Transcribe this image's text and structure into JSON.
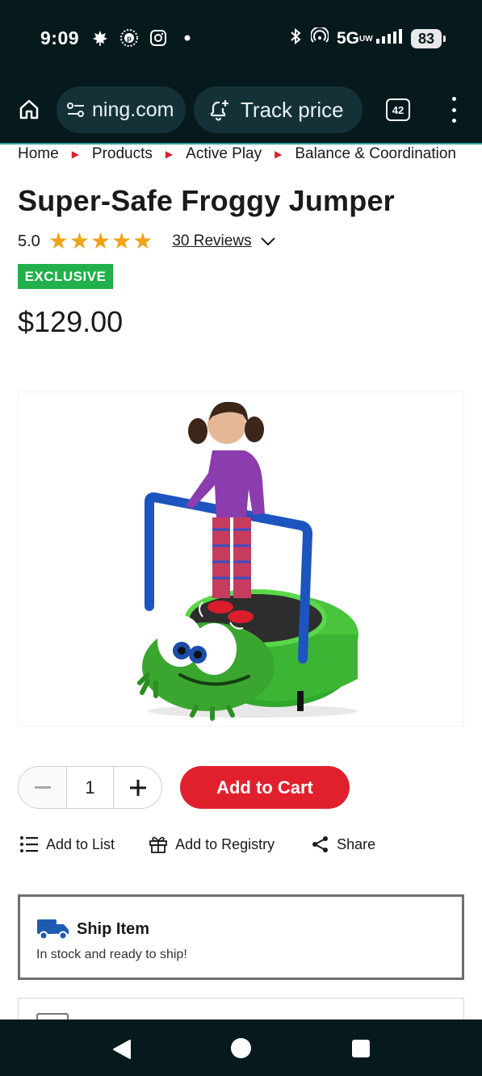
{
  "status_bar": {
    "time": "9:09",
    "network": "5G",
    "network_sub": "UW",
    "battery": "83"
  },
  "browser": {
    "url": "ning.com",
    "track_price": "Track price",
    "tab_count": "42"
  },
  "breadcrumb": [
    "Home",
    "Products",
    "Active Play",
    "Balance & Coordination"
  ],
  "product": {
    "title": "Super-Safe Froggy Jumper",
    "rating": "5.0",
    "stars": 5,
    "reviews": "30 Reviews",
    "badge": "EXCLUSIVE",
    "price": "$129.00"
  },
  "purchase": {
    "quantity": "1",
    "add_to_cart": "Add to Cart"
  },
  "actions": {
    "add_to_list": "Add to List",
    "add_to_registry": "Add to Registry",
    "share": "Share"
  },
  "shipping": {
    "title": "Ship Item",
    "subtitle": "In stock and ready to ship!"
  },
  "colors": {
    "brand_red": "#e1202e",
    "exclusive_green": "#21b04b",
    "star_gold": "#f2a216",
    "chrome_dark": "#06191d"
  }
}
